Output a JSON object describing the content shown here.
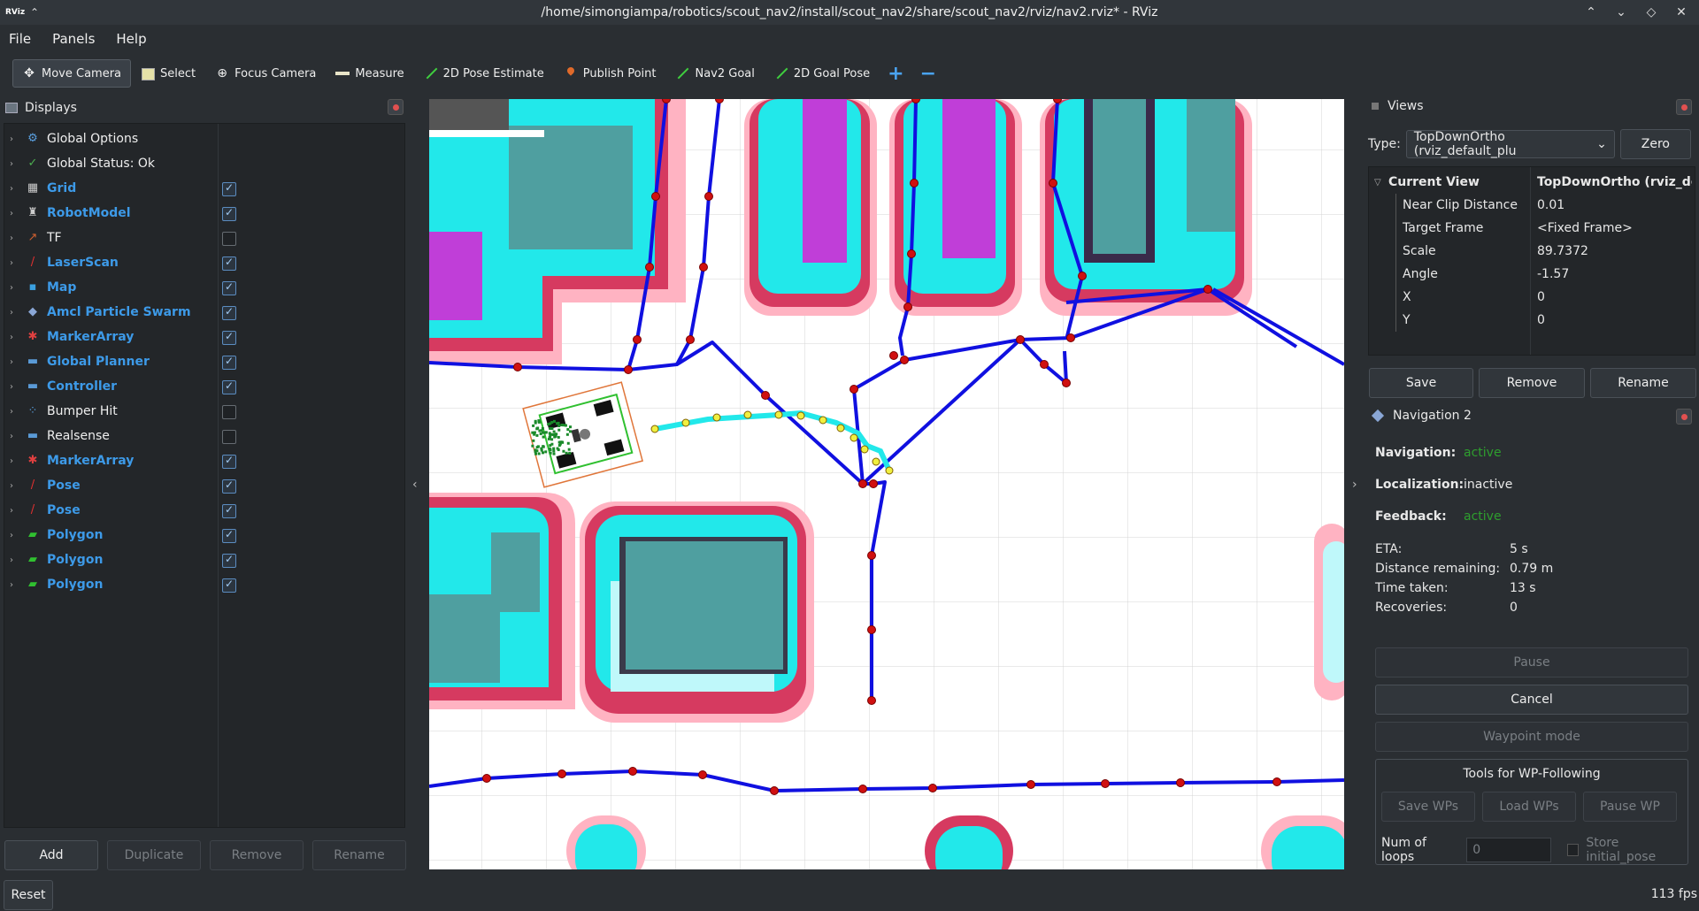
{
  "window": {
    "title": "/home/simongiampa/robotics/scout_nav2/install/scout_nav2/share/scout_nav2/rviz/nav2.rviz* - RViz",
    "app_label": "RViz"
  },
  "menu": [
    "File",
    "Panels",
    "Help"
  ],
  "toolbar": {
    "tools": [
      {
        "label": "Move Camera",
        "icon": "move-icon",
        "active": true
      },
      {
        "label": "Select",
        "icon": "select-icon"
      },
      {
        "label": "Focus Camera",
        "icon": "focus-icon"
      },
      {
        "label": "Measure",
        "icon": "measure-icon"
      },
      {
        "label": "2D Pose Estimate",
        "icon": "arrow-green-icon"
      },
      {
        "label": "Publish Point",
        "icon": "pin-icon"
      },
      {
        "label": "Nav2 Goal",
        "icon": "arrow-green-icon"
      },
      {
        "label": "2D Goal Pose",
        "icon": "arrow-green-icon"
      }
    ],
    "plus": "+",
    "minus": "−"
  },
  "displays": {
    "title": "Displays",
    "items": [
      {
        "label": "Global Options",
        "icon": "⚙",
        "color": "#5aa0e0",
        "style": "plain"
      },
      {
        "label": "Global Status: Ok",
        "icon": "✓",
        "color": "#4caf50",
        "style": "plain"
      },
      {
        "label": "Grid",
        "icon": "▦",
        "color": "#cccccc",
        "style": "blue",
        "checked": true
      },
      {
        "label": "RobotModel",
        "icon": "♜",
        "color": "#cccccc",
        "style": "blue",
        "checked": true
      },
      {
        "label": "TF",
        "icon": "↗",
        "color": "#d06030",
        "style": "plain",
        "checked": false
      },
      {
        "label": "LaserScan",
        "icon": "/",
        "color": "#e03030",
        "style": "blue",
        "checked": true
      },
      {
        "label": "Map",
        "icon": "▪",
        "color": "#3aa0e0",
        "style": "blue",
        "checked": true
      },
      {
        "label": "Amcl Particle Swarm",
        "icon": "◆",
        "color": "#8aa7d6",
        "style": "blue",
        "checked": true
      },
      {
        "label": "MarkerArray",
        "icon": "✱",
        "color": "#e04040",
        "style": "blue",
        "checked": true
      },
      {
        "label": "Global Planner",
        "icon": "▬",
        "color": "#5a9ad6",
        "style": "blue",
        "checked": true
      },
      {
        "label": "Controller",
        "icon": "▬",
        "color": "#5a9ad6",
        "style": "blue",
        "checked": true
      },
      {
        "label": "Bumper Hit",
        "icon": "⁘",
        "color": "#5aa0e0",
        "style": "plain",
        "checked": false
      },
      {
        "label": "Realsense",
        "icon": "▬",
        "color": "#5a9ad6",
        "style": "plain",
        "checked": false
      },
      {
        "label": "MarkerArray",
        "icon": "✱",
        "color": "#e04040",
        "style": "blue",
        "checked": true
      },
      {
        "label": "Pose",
        "icon": "/",
        "color": "#e03030",
        "style": "blue",
        "checked": true
      },
      {
        "label": "Pose",
        "icon": "/",
        "color": "#e03030",
        "style": "blue",
        "checked": true
      },
      {
        "label": "Polygon",
        "icon": "▰",
        "color": "#30c030",
        "style": "blue",
        "checked": true
      },
      {
        "label": "Polygon",
        "icon": "▰",
        "color": "#30c030",
        "style": "blue",
        "checked": true
      },
      {
        "label": "Polygon",
        "icon": "▰",
        "color": "#30c030",
        "style": "blue",
        "checked": true
      }
    ],
    "buttons": {
      "add": "Add",
      "duplicate": "Duplicate",
      "remove": "Remove",
      "rename": "Rename"
    }
  },
  "views": {
    "title": "Views",
    "type_label": "Type:",
    "type_value": "TopDownOrtho (rviz_default_plu",
    "zero": "Zero",
    "root_key": "Current View",
    "root_value": "TopDownOrtho (rviz_def...",
    "props": [
      {
        "k": "Near Clip Distance",
        "v": "0.01"
      },
      {
        "k": "Target Frame",
        "v": "<Fixed Frame>"
      },
      {
        "k": "Scale",
        "v": "89.7372"
      },
      {
        "k": "Angle",
        "v": "-1.57"
      },
      {
        "k": "X",
        "v": "0"
      },
      {
        "k": "Y",
        "v": "0"
      }
    ],
    "buttons": {
      "save": "Save",
      "remove": "Remove",
      "rename": "Rename"
    }
  },
  "nav": {
    "title": "Navigation 2",
    "navigation_k": "Navigation:",
    "navigation_v": "active",
    "localization_k": "Localization:",
    "localization_v": "inactive",
    "feedback_k": "Feedback:",
    "feedback_v": "active",
    "eta_k": "ETA:",
    "eta_v": "5 s",
    "dist_k": "Distance remaining:",
    "dist_v": "0.79 m",
    "time_k": "Time taken:",
    "time_v": "13 s",
    "rec_k": "Recoveries:",
    "rec_v": "0",
    "pause": "Pause",
    "cancel": "Cancel",
    "waypoint": "Waypoint mode",
    "wp_title": "Tools for WP-Following",
    "save_wps": "Save WPs",
    "load_wps": "Load WPs",
    "pause_wp": "Pause WP",
    "loops_label": "Num of loops",
    "loops_value": "0",
    "store_pose": "Store initial_pose",
    "active_color": "#2e9e2e"
  },
  "status": {
    "reset": "Reset",
    "fps": "113 fps"
  }
}
